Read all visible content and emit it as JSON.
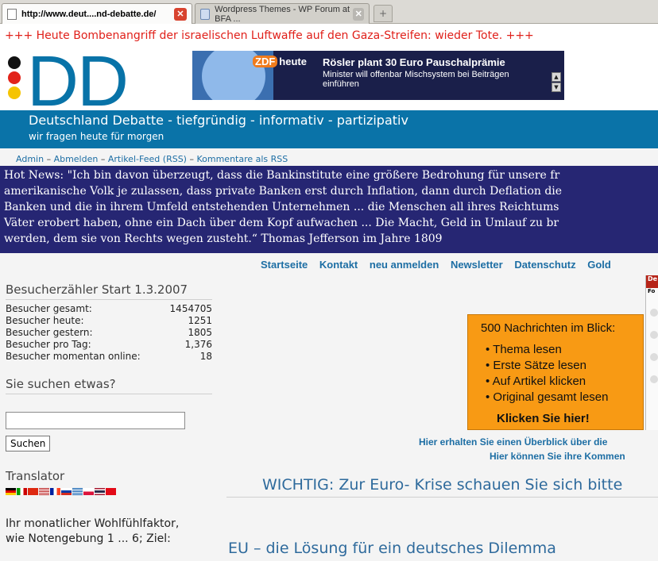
{
  "browser": {
    "tabs": [
      {
        "title": "http://www.deut....nd-debatte.de/",
        "active": true
      },
      {
        "title": "Wordpress Themes - WP Forum at BFA ...",
        "active": false
      }
    ]
  },
  "ticker": "+++ Heute Bombenangriff der israelischen Luftwaffe auf den Gaza-Streifen: wieder Tote. +++",
  "header": {
    "logo": "DD",
    "tagline": "Deutschland Debatte - tiefgründig - informativ - partizipativ",
    "subtag": "wir fragen heute für morgen",
    "banner": {
      "brand_badge": "ZDF",
      "brand": "heute",
      "headline": "Rösler plant 30 Euro Pauschalprämie",
      "sub": "Minister will offenbar Mischsystem bei Beiträgen einführen"
    }
  },
  "adminbar": {
    "admin": "Admin",
    "logout": "Abmelden",
    "feed": "Artikel-Feed (RSS)",
    "comments": "Kommentare als RSS"
  },
  "hotnews": {
    "lines": [
      "Hot News: \"Ich bin davon überzeugt, dass die Bankinstitute eine größere Bedrohung für unsere fr",
      "amerikanische Volk je zulassen, dass private Banken erst durch Inflation, dann durch Deflation die",
      "Banken und die in ihrem Umfeld entstehenden Unternehmen ... die Menschen all ihres Reichtums",
      "Väter erobert haben, ohne ein Dach über dem Kopf aufwachen ... Die Macht, Geld in Umlauf zu br",
      "werden, dem sie von Rechts wegen zusteht.“ Thomas Jefferson im Jahre 1809"
    ]
  },
  "topnav": [
    "Startseite",
    "Kontakt",
    "neu anmelden",
    "Newsletter",
    "Datenschutz",
    "Gold"
  ],
  "sidebar": {
    "counter_title": "Besucherzähler Start 1.3.2007",
    "counter_rows": [
      {
        "label": "Besucher gesamt:",
        "value": "1454705"
      },
      {
        "label": "Besucher heute:",
        "value": "1251"
      },
      {
        "label": "Besucher gestern:",
        "value": "1805"
      },
      {
        "label": "Besucher pro Tag:",
        "value": "1,376"
      },
      {
        "label": "Besucher momentan online:",
        "value": "18"
      }
    ],
    "search_title": "Sie suchen etwas?",
    "search_value": "",
    "search_button": "Suchen",
    "translator_title": "Translator",
    "wohl_line1": "Ihr monatlicher Wohlfühlfaktor,",
    "wohl_line2": "wie Notengebung 1 ... 6; Ziel:"
  },
  "promo": {
    "title": "500 Nachrichten im Blick:",
    "items": [
      "Thema lesen",
      "Erste Sätze lesen",
      "Auf Artikel klicken",
      "Original gesamt lesen"
    ],
    "cta": "Klicken Sie hier!"
  },
  "side_widget": {
    "top": "De",
    "sub": "Fo"
  },
  "info1": "Hier erhalten Sie einen Überblick über die",
  "info2": "Hier können Sie ihre Kommen",
  "wichtig": "WICHTIG: Zur Euro- Krise schauen Sie sich bitte",
  "article_title": "EU – die Lösung für ein deutsches Dilemma",
  "colors": {
    "brand_blue": "#0a73a8",
    "hotnews_bg": "#262673",
    "ticker_red": "#e0201a",
    "promo_orange": "#f89a14"
  },
  "icons": {
    "tab_page": "page-icon",
    "tab_close": "close-icon",
    "new_tab": "plus-icon"
  }
}
